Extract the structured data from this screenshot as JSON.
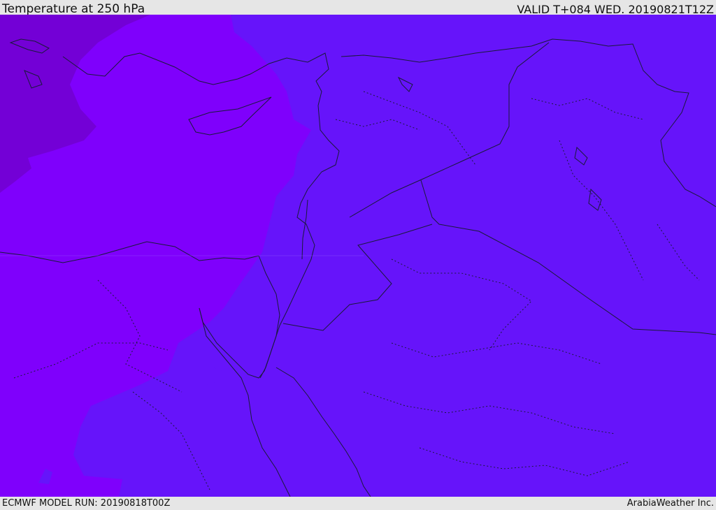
{
  "header": {
    "title": "Temperature at 250 hPa",
    "valid": "VALID T+084 WED. 20190821T12Z"
  },
  "footer": {
    "model_run": "ECMWF MODEL RUN: 20190818T00Z",
    "credit": "ArabiaWeather Inc."
  },
  "colors": {
    "warm_fill": "#6614fa",
    "mid_fill": "#7f00fc",
    "cold_fill": "#7300d6",
    "border_line": "#1a1a3a"
  }
}
